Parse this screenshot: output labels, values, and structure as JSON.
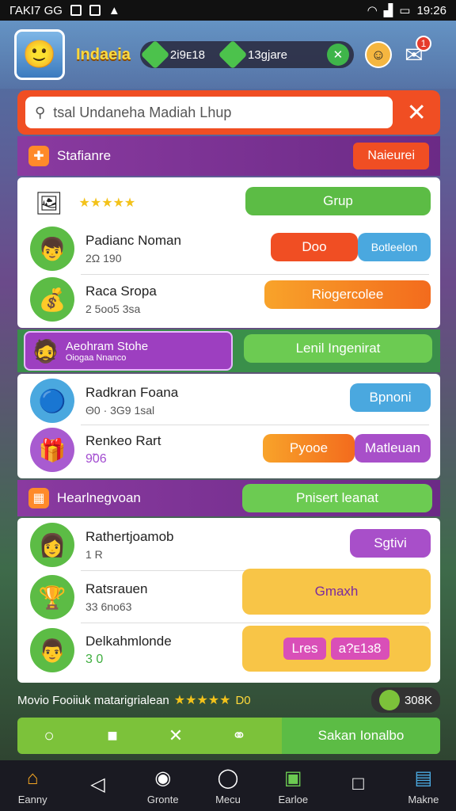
{
  "status": {
    "left_text": "ΓΑΚΙ7 GG",
    "time": "19:26"
  },
  "header": {
    "title": "Indaeia",
    "currency_1": "2і9ᴇ18",
    "currency_2": "13gjare"
  },
  "search": {
    "value": "tsal Undaneha Madiah Lhup"
  },
  "band1": {
    "title": "Stafianre",
    "button": "Naieurei"
  },
  "group_list": {
    "top_button": "Grup",
    "rows": [
      {
        "name": "Padianc Noman",
        "sub": "2Ω 190",
        "button": "Doo",
        "button2": "Botleelon"
      },
      {
        "name": "Raca Sropa",
        "sub": "2 5oo5 3sa",
        "button": "Riogercolee"
      }
    ]
  },
  "highlight": {
    "title": "Aeohram Stohe",
    "sub": "Oiogaa Nnanco",
    "button": "Lenil Ingenirat"
  },
  "list2": {
    "rows": [
      {
        "name": "Radkran Foana",
        "sub": "Θ0 · 3G9 1sal",
        "button": "Bpnoni"
      },
      {
        "name": "Renkeo Rart",
        "sub": "9̃06",
        "button": "Pyooe",
        "button2": "Matleuan"
      }
    ]
  },
  "band2": {
    "title": "Hearlnegvoan",
    "button": "Pnisert leanat"
  },
  "list3": {
    "rows": [
      {
        "name": "Rathertjoamob",
        "sub": "1 R",
        "button": "Sgtivi"
      },
      {
        "name": "Ratsrauen",
        "sub": "33 6no63",
        "button": "Gmaxh"
      },
      {
        "name": "Delkahmlonde",
        "sub": "3 0",
        "button": "Lres",
        "value": "a?ᴇ1ɜ8"
      }
    ]
  },
  "footer": {
    "text": "Movio Fooiiuk matarigrialean",
    "value": "D0",
    "coins": "308K"
  },
  "action_bar": {
    "main": "Sakan Ionalbo"
  },
  "nav": [
    {
      "label": "Eanny",
      "icon": "home-icon"
    },
    {
      "label": "",
      "icon": "back-icon"
    },
    {
      "label": "Gronte",
      "icon": "camera-icon"
    },
    {
      "label": "Mecu",
      "icon": "circle-icon"
    },
    {
      "label": "Earloe",
      "icon": "leaf-icon"
    },
    {
      "label": "",
      "icon": "square-icon"
    },
    {
      "label": "Makne",
      "icon": "map-icon"
    }
  ]
}
